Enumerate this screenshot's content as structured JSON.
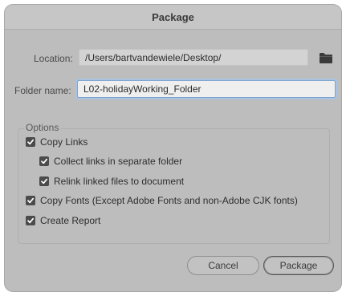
{
  "dialog": {
    "title": "Package"
  },
  "location": {
    "label": "Location:",
    "value": "/Users/bartvandewiele/Desktop/",
    "icon": "folder-icon"
  },
  "folder_name": {
    "label": "Folder name:",
    "value": "L02-holidayWorking_Folder"
  },
  "options": {
    "title": "Options",
    "items": [
      {
        "label": "Copy Links",
        "checked": true
      },
      {
        "label": "Collect links in separate folder",
        "checked": true
      },
      {
        "label": "Relink linked files to document",
        "checked": true
      },
      {
        "label": "Copy Fonts (Except Adobe Fonts and non-Adobe CJK fonts)",
        "checked": true
      },
      {
        "label": "Create Report",
        "checked": true
      }
    ]
  },
  "buttons": {
    "cancel": "Cancel",
    "package": "Package"
  }
}
